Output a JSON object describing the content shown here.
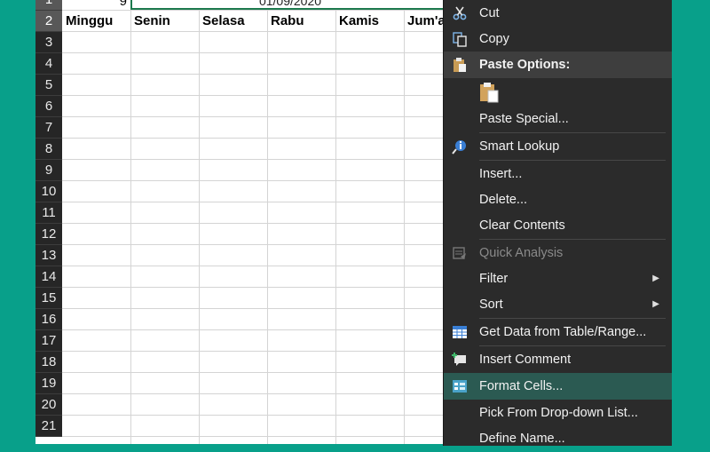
{
  "sheet": {
    "row_numbers": [
      "1",
      "2",
      "3",
      "4",
      "5",
      "6",
      "7",
      "8",
      "9",
      "10",
      "11",
      "12",
      "13",
      "14",
      "15",
      "16",
      "17",
      "18",
      "19",
      "20",
      "21"
    ],
    "row1": {
      "value": "9",
      "merged_date": "01/09/2020"
    },
    "headers": [
      "Minggu",
      "Senin",
      "Selasa",
      "Rabu",
      "Kamis",
      "Jum'a"
    ]
  },
  "context_menu": {
    "cut": "Cut",
    "copy": "Copy",
    "paste_options": "Paste Options:",
    "paste_special": "Paste Special...",
    "smart_lookup": "Smart Lookup",
    "insert": "Insert...",
    "delete": "Delete...",
    "clear_contents": "Clear Contents",
    "quick_analysis": "Quick Analysis",
    "filter": "Filter",
    "sort": "Sort",
    "get_data": "Get Data from Table/Range...",
    "insert_comment": "Insert Comment",
    "format_cells": "Format Cells...",
    "pick_from_list": "Pick From Drop-down List...",
    "define_name": "Define Name..."
  },
  "colors": {
    "accent": "#08a08a",
    "menu_bg": "#2b2b2b",
    "menu_highlight": "#2b5a52",
    "selection_border": "#1d7a4e"
  }
}
